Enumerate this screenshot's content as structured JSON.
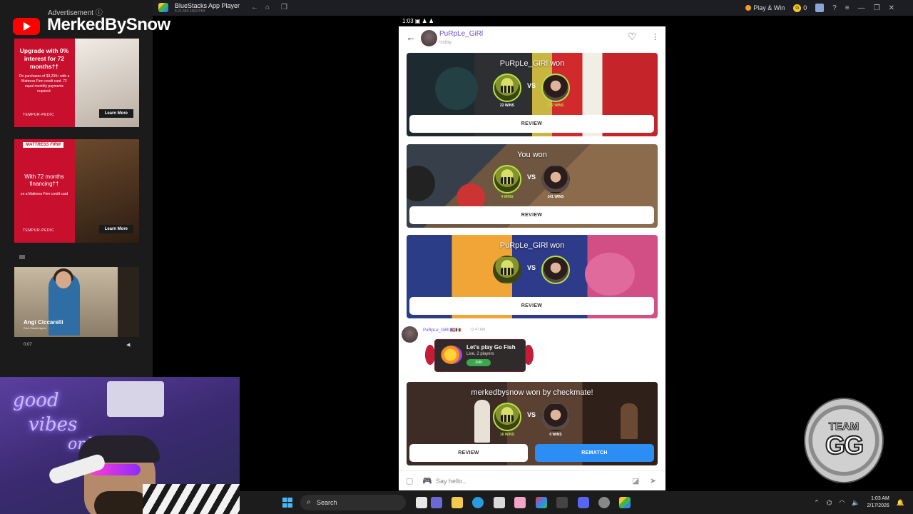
{
  "titlebar": {
    "app_name": "BlueStacks App Player",
    "version": "5.21.640.1002 P64",
    "play_win": "Play & Win",
    "coins": "0"
  },
  "ads": {
    "header": "Advertisement ⓘ",
    "ad1": {
      "headline": "Upgrade with 0% interest for 72 months††",
      "fine": "On purchases of $3,299+ with a Mattress Firm credit card. 72 equal monthly payments required.",
      "brand": "TEMPUR-PEDIC",
      "cta": "Learn More"
    },
    "ad2": {
      "badge": "MATTRESS FIRM",
      "headline": "With 72 months financing††",
      "fine": "on a Mattress Firm credit card",
      "brand": "TEMPUR-PEDIC",
      "cta": "Learn More"
    },
    "ad3": {
      "name": "Angi Ciccarelli",
      "role": "Real Estate Agent",
      "time": "0:07"
    }
  },
  "channel": {
    "name": "MerkedBySnow"
  },
  "webcam": {
    "neon": [
      "good",
      "vibes",
      "only"
    ]
  },
  "phone": {
    "status_time": "1:03",
    "header": {
      "name": "PuRpLe_GiRl",
      "sub": "today"
    },
    "cards": [
      {
        "result": "PuRpLe_GiRl won",
        "left_wins": "22 WINS",
        "right_wins": "932 WINS",
        "button": "REVIEW"
      },
      {
        "result": "You won",
        "left_wins": "4 WINS",
        "right_wins": "341 WINS",
        "button": "REVIEW"
      },
      {
        "result": "PuRpLe_GiRl won",
        "left_wins": "",
        "right_wins": "",
        "button": "REVIEW"
      },
      {
        "result": "merkedbysnow won by checkmate!",
        "left_wins": "16 WINS",
        "right_wins": "0 WINS",
        "button": "REVIEW",
        "button2": "REMATCH"
      }
    ],
    "vs": "VS",
    "chat": {
      "name": "PuRpLe_GiRl 🇵🇷🇲🇽",
      "time": "12:47 AM",
      "title": "Let's play Go Fish",
      "sub": "Live, 2 players",
      "join": "Join"
    },
    "input_placeholder": "Say hello..."
  },
  "badge": {
    "team": "TEAM",
    "gg": "GG"
  },
  "taskbar": {
    "search": "Search",
    "time": "1:03 AM",
    "date": "2/17/2026"
  },
  "colors": {
    "accent_purple": "#6a4ad8",
    "rematch_blue": "#2c8ef5",
    "win_green": "#b6e243"
  }
}
